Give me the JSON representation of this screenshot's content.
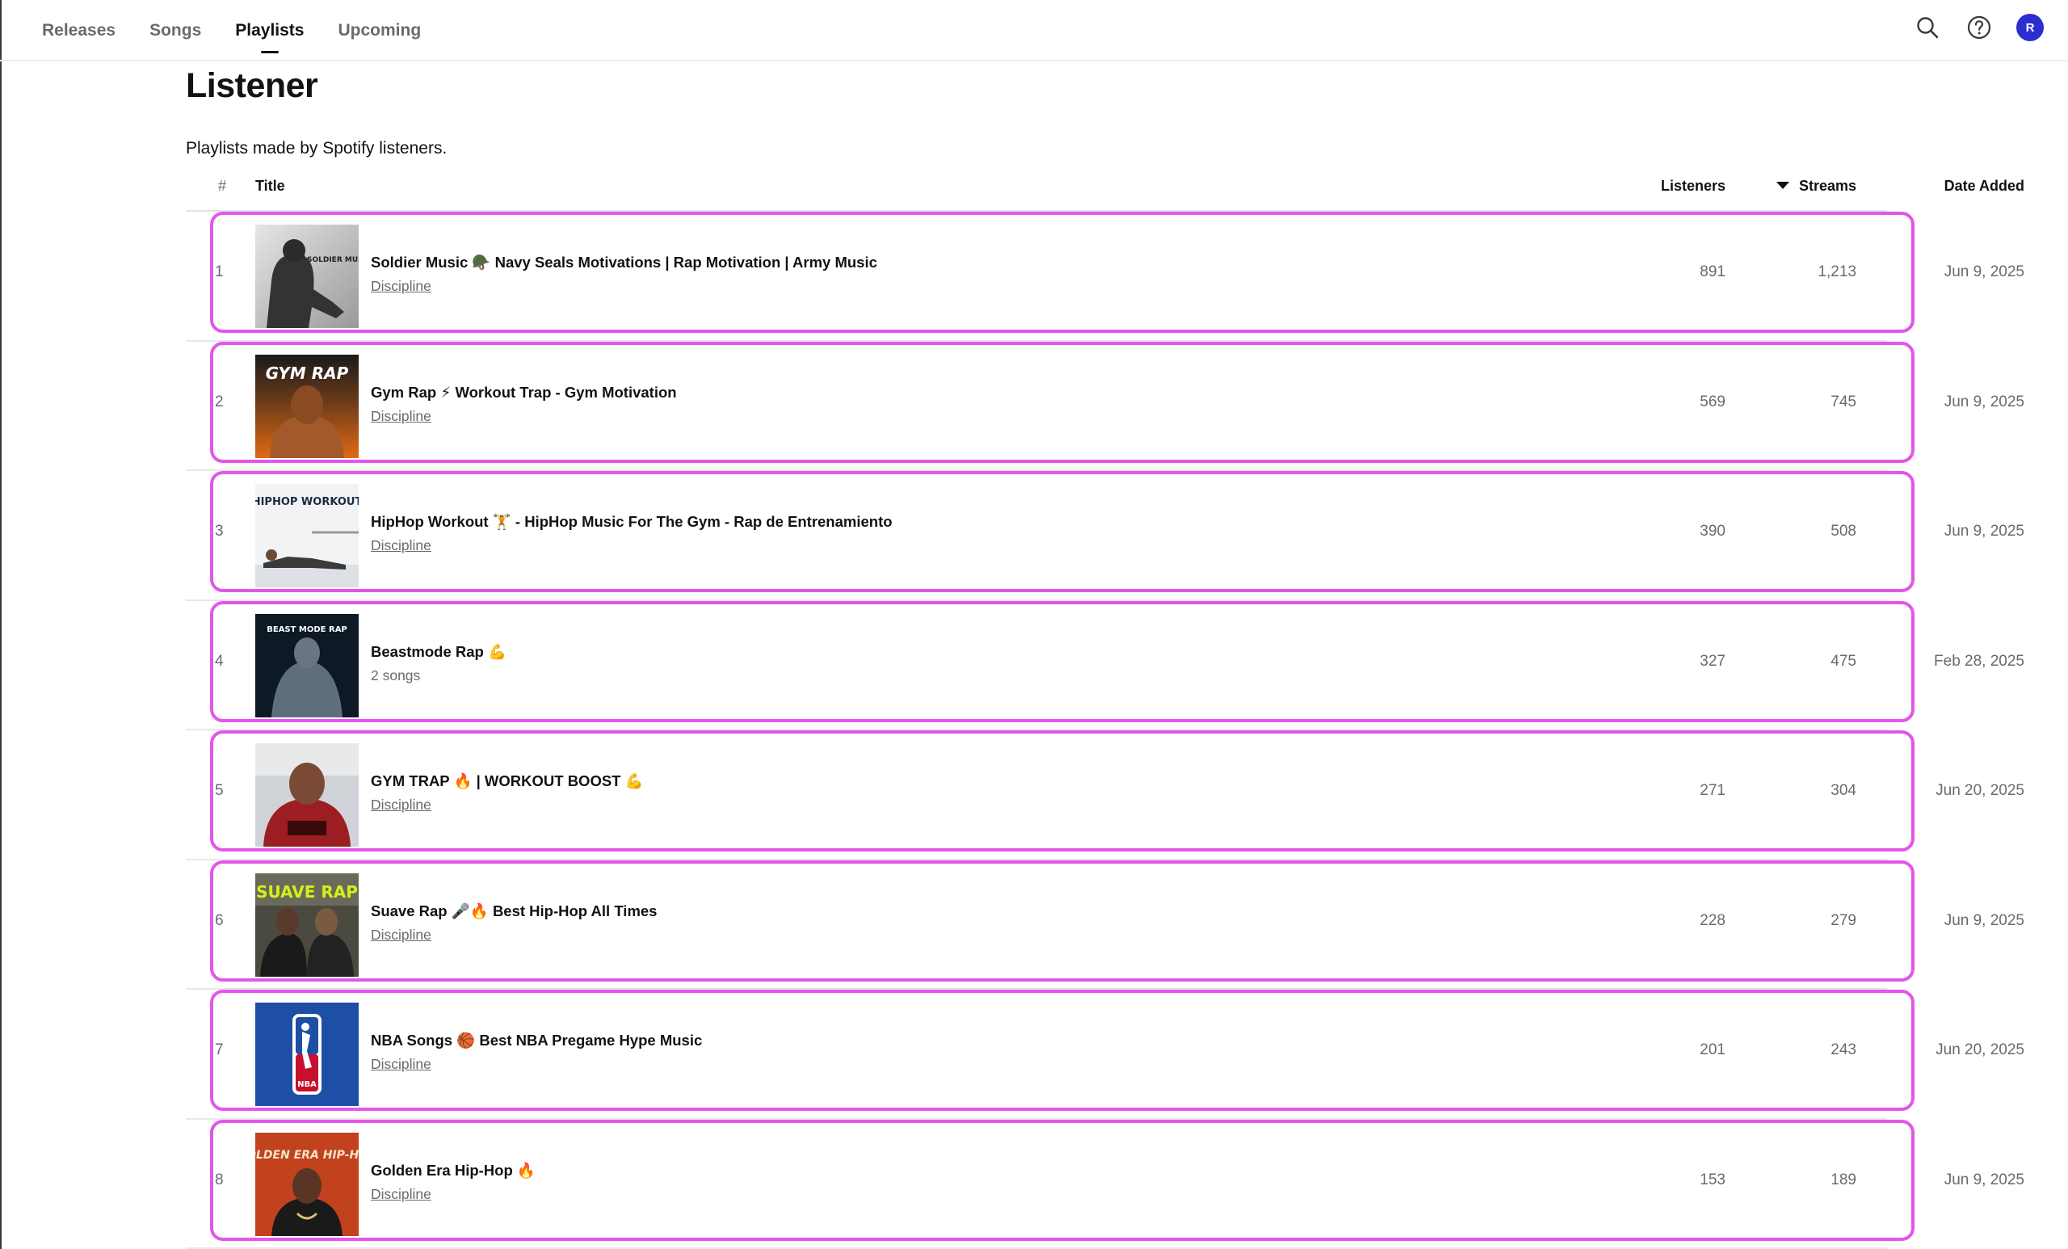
{
  "nav": {
    "tabs": [
      {
        "label": "Releases"
      },
      {
        "label": "Songs"
      },
      {
        "label": "Playlists"
      },
      {
        "label": "Upcoming"
      }
    ],
    "active_tab": "Playlists",
    "avatar_initial": "R"
  },
  "header": {
    "title": "Listener",
    "subtitle": "Playlists made by Spotify listeners."
  },
  "table": {
    "columns": {
      "num": "#",
      "title": "Title",
      "listeners": "Listeners",
      "streams": "Streams",
      "date_added": "Date Added"
    },
    "sorted_by": "Streams",
    "sort_direction": "descending",
    "highlight_color": "#e455ea",
    "rows": [
      {
        "num": "1",
        "title": "Soldier Music 🪖 Navy Seals Motivations | Rap Motivation | Army Music",
        "sub": "Discipline",
        "listeners": "891",
        "streams": "1,213",
        "date": "Jun 9, 2025",
        "art_text": "SOLDIER MUSIC"
      },
      {
        "num": "2",
        "title": "Gym Rap ⚡ Workout Trap - Gym Motivation",
        "sub": "Discipline",
        "listeners": "569",
        "streams": "745",
        "date": "Jun 9, 2025",
        "art_text": "GYM RAP"
      },
      {
        "num": "3",
        "title": "HipHop Workout 🏋 - HipHop Music For The Gym - Rap de Entrenamiento",
        "sub": "Discipline",
        "listeners": "390",
        "streams": "508",
        "date": "Jun 9, 2025",
        "art_text": "HIPHOP WORKOUT"
      },
      {
        "num": "4",
        "title": "Beastmode Rap 💪",
        "sub": "2 songs",
        "listeners": "327",
        "streams": "475",
        "date": "Feb 28, 2025",
        "art_text": "BEAST MODE RAP"
      },
      {
        "num": "5",
        "title": "GYM TRAP 🔥 | WORKOUT BOOST 💪",
        "sub": "Discipline",
        "listeners": "271",
        "streams": "304",
        "date": "Jun 20, 2025",
        "art_text": ""
      },
      {
        "num": "6",
        "title": "Suave Rap 🎤🔥 Best Hip-Hop All Times",
        "sub": "Discipline",
        "listeners": "228",
        "streams": "279",
        "date": "Jun 9, 2025",
        "art_text": "SUAVE RAP"
      },
      {
        "num": "7",
        "title": "NBA Songs 🏀 Best NBA Pregame Hype Music",
        "sub": "Discipline",
        "listeners": "201",
        "streams": "243",
        "date": "Jun 20, 2025",
        "art_text": "NBA"
      },
      {
        "num": "8",
        "title": "Golden Era Hip-Hop 🔥",
        "sub": "Discipline",
        "listeners": "153",
        "streams": "189",
        "date": "Jun 9, 2025",
        "art_text": "GOLDEN ERA HIP-HOP"
      }
    ]
  }
}
